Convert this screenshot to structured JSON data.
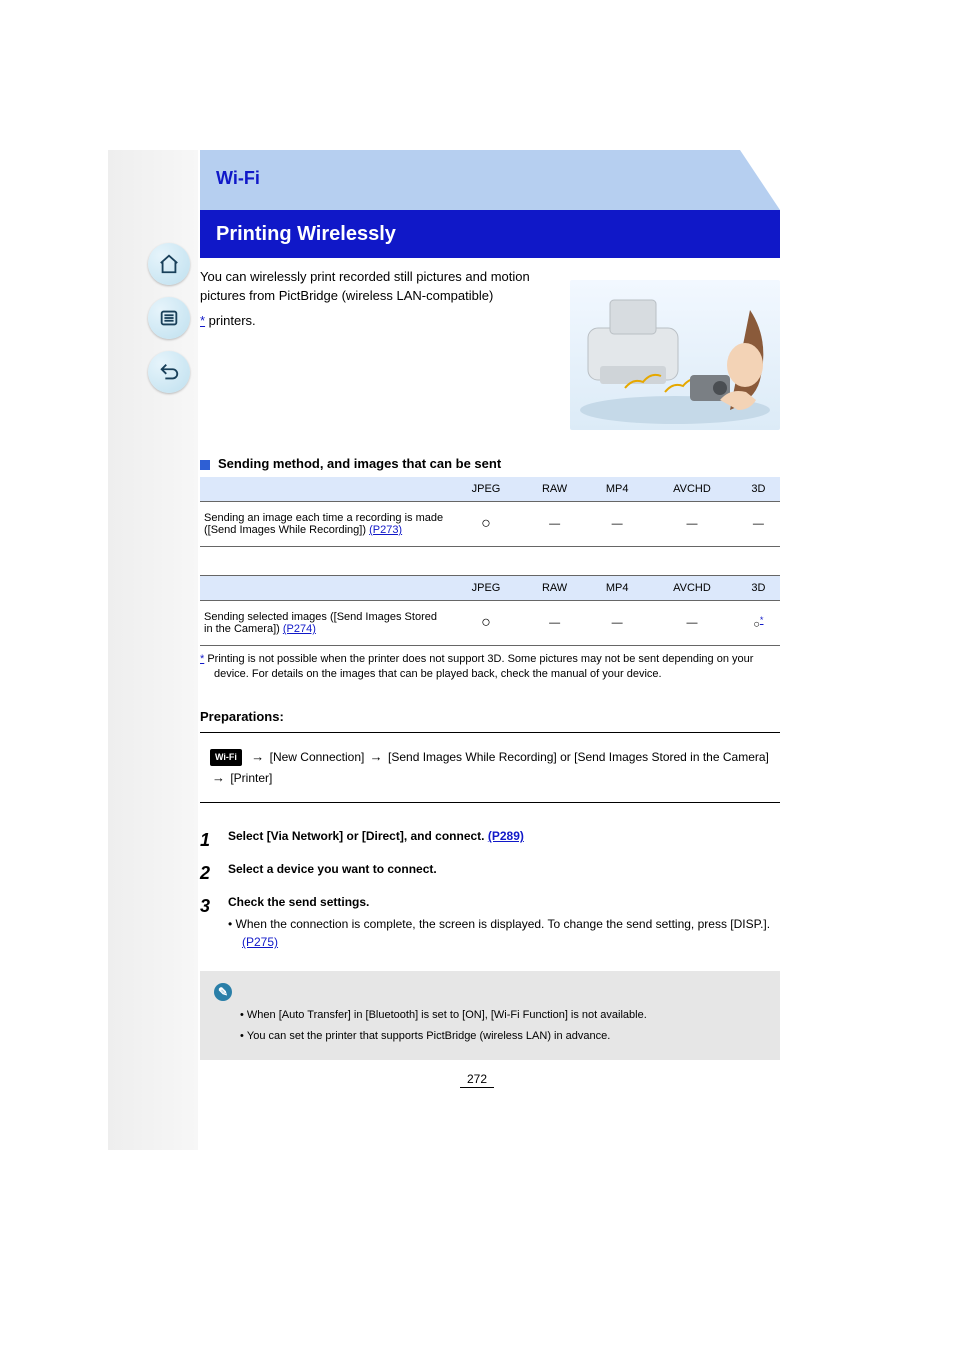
{
  "banner": {
    "category": "Wi-Fi",
    "title": "Printing Wirelessly"
  },
  "intro": {
    "p1": "You can wirelessly print recorded still pictures and motion pictures from PictBridge (wireless LAN-compatible)",
    "p2_suffix": " printers.",
    "p2_link_label": "*"
  },
  "sending_method": {
    "heading": "Sending method, and images that can be sent",
    "cols": [
      "JPEG",
      "RAW",
      "MP4",
      "AVCHD",
      "3D"
    ],
    "row_label": "Sending an image each time a recording is made ([Send Images While Recording])",
    "row_link": "(P273)",
    "row_vals": [
      "circle",
      "—",
      "—",
      "—",
      "—"
    ],
    "row2_label": "Sending selected images ([Send Images Stored in the Camera])",
    "row2_link": "(P274)",
    "footnote_marker": "*",
    "second_cols": [
      "JPEG",
      "RAW",
      "MP4",
      "AVCHD",
      "3D"
    ],
    "second_row_vals": [
      "circle",
      "—",
      "—",
      "—",
      "circle_ast"
    ],
    "footnote": "Printing is not possible when the printer does not support 3D. Some pictures may not be sent depending on your device. For details on the images that can be played back, check the manual of your device."
  },
  "prep": {
    "heading": "Preparations:",
    "wifi_label": "Wi-Fi",
    "seg1": " [New Connection] ",
    "seg2": " [Send Images While Recording] or [Send Images Stored in the Camera] ",
    "seg3": " [Printer]"
  },
  "steps": {
    "s1": {
      "num": "1",
      "title": "Select [Via Network] or [Direct], and connect.",
      "link": "(P289)"
    },
    "s2": {
      "num": "2",
      "title": "Select a device you want to connect."
    },
    "s3": {
      "num": "3",
      "title": "Check the send settings.",
      "sub1_prefix": "• When the connection is complete, the screen is displayed. To change the send setting, press [DISP.]. ",
      "sub1_link": "(P275)"
    }
  },
  "note": {
    "bullets": [
      "When [Auto Transfer] in [Bluetooth] is set to [ON], [Wi-Fi Function] is not available.",
      "You can set the printer that supports PictBridge (wireless LAN) in advance."
    ]
  },
  "page_number": "272"
}
